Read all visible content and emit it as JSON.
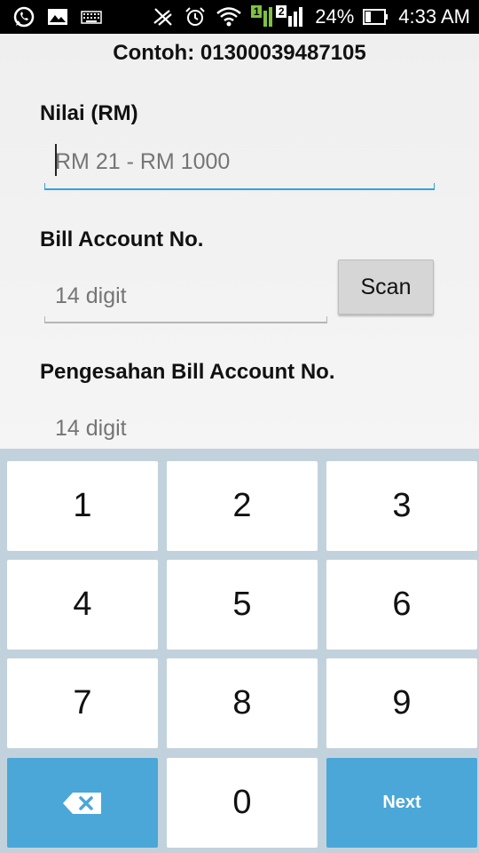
{
  "status_bar": {
    "battery_percent": "24%",
    "time": "4:33 AM",
    "sim1_label": "1",
    "sim2_label": "2",
    "icons_left": [
      "whatsapp-icon",
      "gallery-icon",
      "keyboard-icon"
    ],
    "icons_right": [
      "mute-icon",
      "alarm-icon",
      "wifi-icon",
      "signal-icon",
      "battery-icon"
    ]
  },
  "form": {
    "example_text": "Contoh: 01300039487105",
    "amount": {
      "label": "Nilai (RM)",
      "placeholder": "RM 21 - RM 1000"
    },
    "bill_account": {
      "label": "Bill Account No.",
      "placeholder": "14 digit",
      "scan_label": "Scan"
    },
    "confirm_account": {
      "label": "Pengesahan Bill Account No.",
      "placeholder": "14 digit"
    }
  },
  "keypad": {
    "keys": [
      "1",
      "2",
      "3",
      "4",
      "5",
      "6",
      "7",
      "8",
      "9"
    ],
    "zero": "0",
    "next_label": "Next"
  },
  "colors": {
    "accent": "#33a3dc",
    "key_blue": "#4aa7d8",
    "keypad_bg": "#c2d2dd"
  }
}
